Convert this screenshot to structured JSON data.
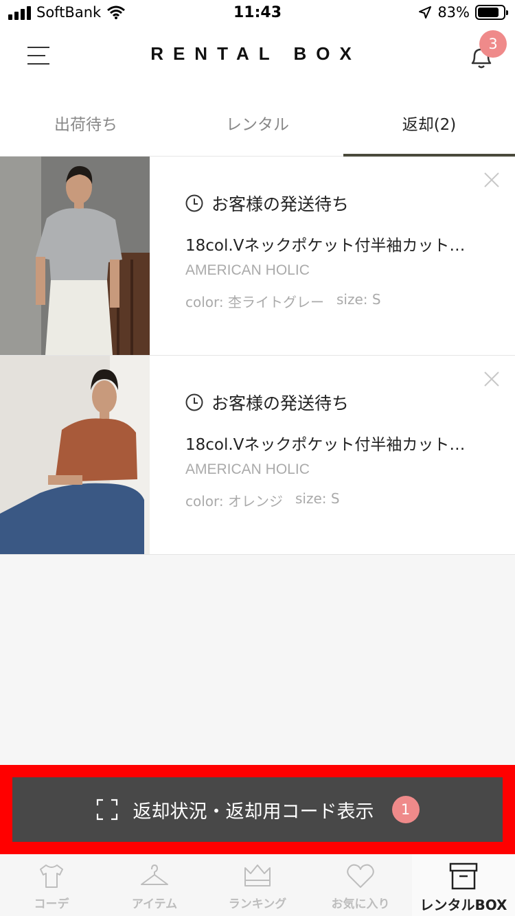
{
  "status_bar": {
    "carrier": "SoftBank",
    "time": "11:43",
    "battery": "83%",
    "battery_level": 0.83
  },
  "header": {
    "logo": "RENTAL BOX",
    "notification_count": "3"
  },
  "tabs": [
    {
      "label": "出荷待ち",
      "active": false
    },
    {
      "label": "レンタル",
      "active": false
    },
    {
      "label": "返却(2)",
      "active": true
    }
  ],
  "items": [
    {
      "status": "お客様の発送待ち",
      "title": "18col.Vネックポケット付半袖カット…",
      "brand": "AMERICAN HOLIC",
      "color": "color: 杢ライトグレー",
      "size": "size: S",
      "shirt_color": "#aeb0b2"
    },
    {
      "status": "お客様の発送待ち",
      "title": "18col.Vネックポケット付半袖カット…",
      "brand": "AMERICAN HOLIC",
      "color": "color: オレンジ",
      "size": "size: S",
      "shirt_color": "#a85a3a"
    }
  ],
  "action": {
    "label": "返却状況・返却用コード表示",
    "badge": "1"
  },
  "bottom_nav": [
    {
      "label": "コーデ",
      "icon": "shirt-icon"
    },
    {
      "label": "アイテム",
      "icon": "hanger-icon"
    },
    {
      "label": "ランキング",
      "icon": "crown-icon"
    },
    {
      "label": "お気に入り",
      "icon": "heart-icon"
    },
    {
      "label": "レンタルBOX",
      "icon": "box-icon",
      "active": true
    }
  ]
}
